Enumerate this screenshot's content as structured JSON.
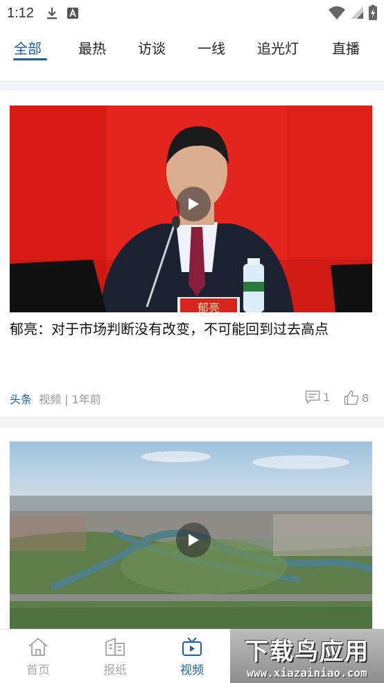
{
  "status_bar": {
    "time": "1:12",
    "icons": [
      "download-icon",
      "a-box-icon",
      "wifi-icon",
      "signal-icon",
      "battery-charging-icon"
    ]
  },
  "tabs": [
    {
      "label": "全部",
      "active": true
    },
    {
      "label": "最热",
      "active": false
    },
    {
      "label": "访谈",
      "active": false
    },
    {
      "label": "一线",
      "active": false
    },
    {
      "label": "追光灯",
      "active": false
    },
    {
      "label": "直播",
      "active": false
    }
  ],
  "feed": [
    {
      "headline": "郁亮：对于市场判断没有改变，不可能回到过去高点",
      "tag": "头条",
      "info": "视频 | 1年前",
      "comments": "1",
      "likes": "8",
      "thumb_type": "press-conference",
      "nameplate": "郁亮"
    },
    {
      "thumb_type": "aerial-city"
    }
  ],
  "bottom_nav": [
    {
      "label": "首页",
      "icon": "home-icon",
      "active": false
    },
    {
      "label": "报纸",
      "icon": "newspaper-icon",
      "active": false
    },
    {
      "label": "视频",
      "icon": "tv-play-icon",
      "active": true
    }
  ],
  "watermark": {
    "cn": "下载鸟应用",
    "en": "www.xiazainiao.com"
  },
  "colors": {
    "accent": "#1a5fa8",
    "inactive": "#aaaaaa",
    "separator": "#f2f3f5"
  }
}
